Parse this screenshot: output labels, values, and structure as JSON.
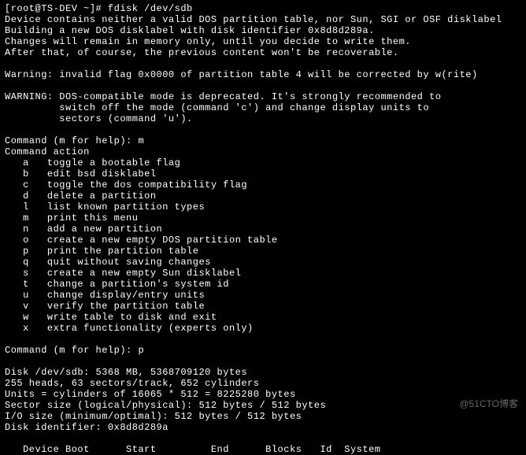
{
  "prompt": {
    "user_host": "[root@TS-DEV ~]#",
    "command": "fdisk /dev/sdb"
  },
  "intro": [
    "Device contains neither a valid DOS partition table, nor Sun, SGI or OSF disklabel",
    "Building a new DOS disklabel with disk identifier 0x8d8d289a.",
    "Changes will remain in memory only, until you decide to write them.",
    "After that, of course, the previous content won't be recoverable."
  ],
  "warning1": "Warning: invalid flag 0x0000 of partition table 4 will be corrected by w(rite)",
  "warning2": [
    "WARNING: DOS-compatible mode is deprecated. It's strongly recommended to",
    "         switch off the mode (command 'c') and change display units to",
    "         sectors (command 'u')."
  ],
  "cmd1": {
    "prompt": "Command (m for help): ",
    "input": "m"
  },
  "action_header": "Command action",
  "actions": [
    {
      "key": "a",
      "desc": "toggle a bootable flag"
    },
    {
      "key": "b",
      "desc": "edit bsd disklabel"
    },
    {
      "key": "c",
      "desc": "toggle the dos compatibility flag"
    },
    {
      "key": "d",
      "desc": "delete a partition"
    },
    {
      "key": "l",
      "desc": "list known partition types"
    },
    {
      "key": "m",
      "desc": "print this menu"
    },
    {
      "key": "n",
      "desc": "add a new partition"
    },
    {
      "key": "o",
      "desc": "create a new empty DOS partition table"
    },
    {
      "key": "p",
      "desc": "print the partition table"
    },
    {
      "key": "q",
      "desc": "quit without saving changes"
    },
    {
      "key": "s",
      "desc": "create a new empty Sun disklabel"
    },
    {
      "key": "t",
      "desc": "change a partition's system id"
    },
    {
      "key": "u",
      "desc": "change display/entry units"
    },
    {
      "key": "v",
      "desc": "verify the partition table"
    },
    {
      "key": "w",
      "desc": "write table to disk and exit"
    },
    {
      "key": "x",
      "desc": "extra functionality (experts only)"
    }
  ],
  "cmd2": {
    "prompt": "Command (m for help): ",
    "input": "p"
  },
  "disk_info": [
    "Disk /dev/sdb: 5368 MB, 5368709120 bytes",
    "255 heads, 63 sectors/track, 652 cylinders",
    "Units = cylinders of 16065 * 512 = 8225280 bytes",
    "Sector size (logical/physical): 512 bytes / 512 bytes",
    "I/O size (minimum/optimal): 512 bytes / 512 bytes",
    "Disk identifier: 0x8d8d289a"
  ],
  "table_header": "   Device Boot      Start         End      Blocks   Id  System",
  "watermark": "@51CTO博客"
}
